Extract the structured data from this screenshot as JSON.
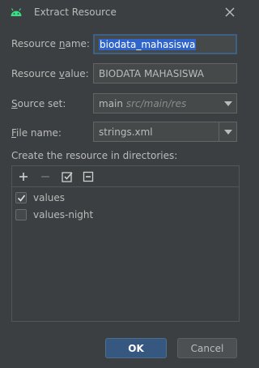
{
  "window": {
    "title": "Extract Resource",
    "app_icon": "android-icon",
    "close_icon": "close-icon"
  },
  "form": {
    "resource_name_label_pre": "Resource ",
    "resource_name_label_mnemonic": "n",
    "resource_name_label_post": "ame:",
    "resource_name_value": "biodata_mahasiswa",
    "resource_value_label_pre": "Resource ",
    "resource_value_label_mnemonic": "v",
    "resource_value_label_post": "alue:",
    "resource_value_value": "BIODATA MAHASISWA",
    "source_set_label_pre": "",
    "source_set_label_mnemonic": "S",
    "source_set_label_post": "ource set:",
    "source_set_value": "main",
    "source_set_path": "src/main/res",
    "file_name_label_pre": "",
    "file_name_label_mnemonic": "F",
    "file_name_label_post": "ile name:",
    "file_name_value": "strings.xml"
  },
  "directories": {
    "label": "Create the resource in directories:",
    "toolbar": [
      "add-icon",
      "remove-icon",
      "select-all-icon",
      "unselect-all-icon"
    ],
    "items": [
      {
        "label": "values",
        "checked": true
      },
      {
        "label": "values-night",
        "checked": false
      }
    ]
  },
  "buttons": {
    "ok_label": "OK",
    "cancel_label": "Cancel"
  },
  "colors": {
    "background": "#3c3f41",
    "field_bg": "#45494a",
    "focus_border": "#3d6185",
    "selection": "#2f65ca",
    "ok_button": "#365880",
    "android_green": "#3ddc84"
  }
}
